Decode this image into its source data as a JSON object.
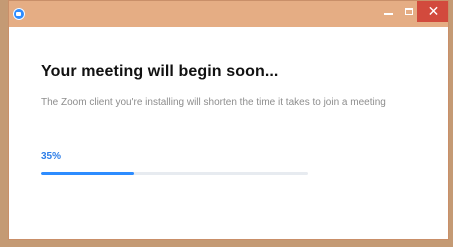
{
  "window": {
    "title_icon": "zoom-app-icon",
    "controls": {
      "minimize_icon": "minimize-icon",
      "maximize_icon": "maximize-icon",
      "close_label": "✕"
    }
  },
  "dialog": {
    "title": "Your meeting will begin soon...",
    "message": "The Zoom client you're installing will shorten the time it takes to join a meeting",
    "progress_label": "35%",
    "progress_value": 0.35
  },
  "colors": {
    "accent": "#2d8cff",
    "titlebar": "#e5ad84",
    "close": "#d24a3d"
  }
}
